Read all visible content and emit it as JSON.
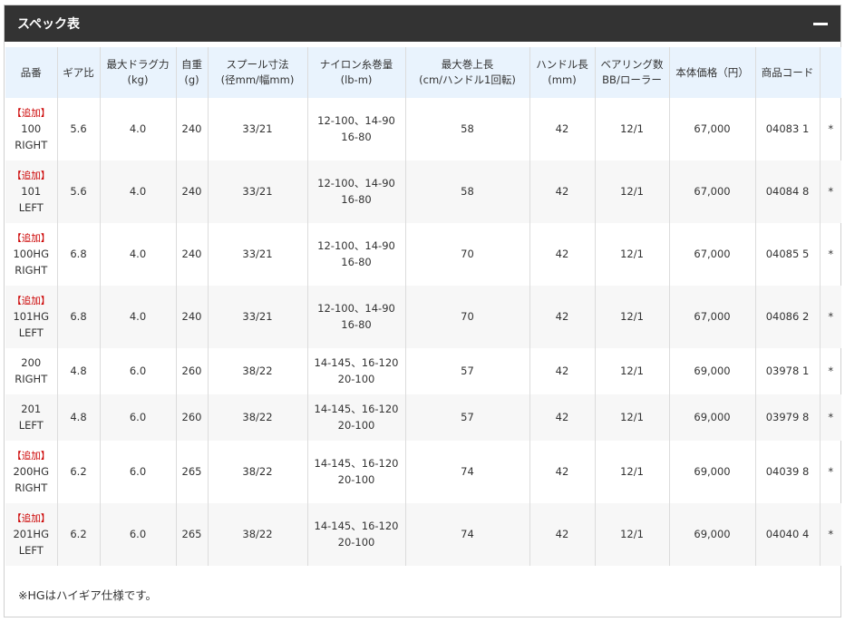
{
  "panel": {
    "title": "スペック表"
  },
  "columns": [
    "品番",
    "ギア比",
    "最大ドラグ力\n(kg)",
    "自重\n(g)",
    "スプール寸法\n(径mm/幅mm)",
    "ナイロン糸巻量\n(lb-m)",
    "最大巻上長\n(cm/ハンドル1回転)",
    "ハンドル長\n(mm)",
    "ベアリング数\nBB/ローラー",
    "本体価格（円）",
    "商品コード",
    ""
  ],
  "rows": [
    {
      "tag": "【追加】",
      "model": "100\nRIGHT",
      "gear": "5.6",
      "drag": "4.0",
      "weight": "240",
      "spool": "33/21",
      "line": "12-100、14-90\n16-80",
      "retrieve": "58",
      "handle": "42",
      "bearing": "12/1",
      "price": "67,000",
      "code": "04083 1",
      "mark": "*"
    },
    {
      "tag": "【追加】",
      "model": "101\nLEFT",
      "gear": "5.6",
      "drag": "4.0",
      "weight": "240",
      "spool": "33/21",
      "line": "12-100、14-90\n16-80",
      "retrieve": "58",
      "handle": "42",
      "bearing": "12/1",
      "price": "67,000",
      "code": "04084 8",
      "mark": "*"
    },
    {
      "tag": "【追加】",
      "model": "100HG\nRIGHT",
      "gear": "6.8",
      "drag": "4.0",
      "weight": "240",
      "spool": "33/21",
      "line": "12-100、14-90\n16-80",
      "retrieve": "70",
      "handle": "42",
      "bearing": "12/1",
      "price": "67,000",
      "code": "04085 5",
      "mark": "*"
    },
    {
      "tag": "【追加】",
      "model": "101HG\nLEFT",
      "gear": "6.8",
      "drag": "4.0",
      "weight": "240",
      "spool": "33/21",
      "line": "12-100、14-90\n16-80",
      "retrieve": "70",
      "handle": "42",
      "bearing": "12/1",
      "price": "67,000",
      "code": "04086 2",
      "mark": "*"
    },
    {
      "tag": "",
      "model": "200\nRIGHT",
      "gear": "4.8",
      "drag": "6.0",
      "weight": "260",
      "spool": "38/22",
      "line": "14-145、16-120\n20-100",
      "retrieve": "57",
      "handle": "42",
      "bearing": "12/1",
      "price": "69,000",
      "code": "03978 1",
      "mark": "*"
    },
    {
      "tag": "",
      "model": "201\nLEFT",
      "gear": "4.8",
      "drag": "6.0",
      "weight": "260",
      "spool": "38/22",
      "line": "14-145、16-120\n20-100",
      "retrieve": "57",
      "handle": "42",
      "bearing": "12/1",
      "price": "69,000",
      "code": "03979 8",
      "mark": "*"
    },
    {
      "tag": "【追加】",
      "model": "200HG\nRIGHT",
      "gear": "6.2",
      "drag": "6.0",
      "weight": "265",
      "spool": "38/22",
      "line": "14-145、16-120\n20-100",
      "retrieve": "74",
      "handle": "42",
      "bearing": "12/1",
      "price": "69,000",
      "code": "04039 8",
      "mark": "*"
    },
    {
      "tag": "【追加】",
      "model": "201HG\nLEFT",
      "gear": "6.2",
      "drag": "6.0",
      "weight": "265",
      "spool": "38/22",
      "line": "14-145、16-120\n20-100",
      "retrieve": "74",
      "handle": "42",
      "bearing": "12/1",
      "price": "69,000",
      "code": "04040 4",
      "mark": "*"
    }
  ],
  "note": "※HGはハイギア仕様です。",
  "colors": {
    "header_bg": "#333333",
    "th_bg": "#e9f3fd",
    "alt_row": "#f7f7f7",
    "tag": "#cc0000"
  },
  "icons": {
    "collapse": "minus-icon"
  }
}
